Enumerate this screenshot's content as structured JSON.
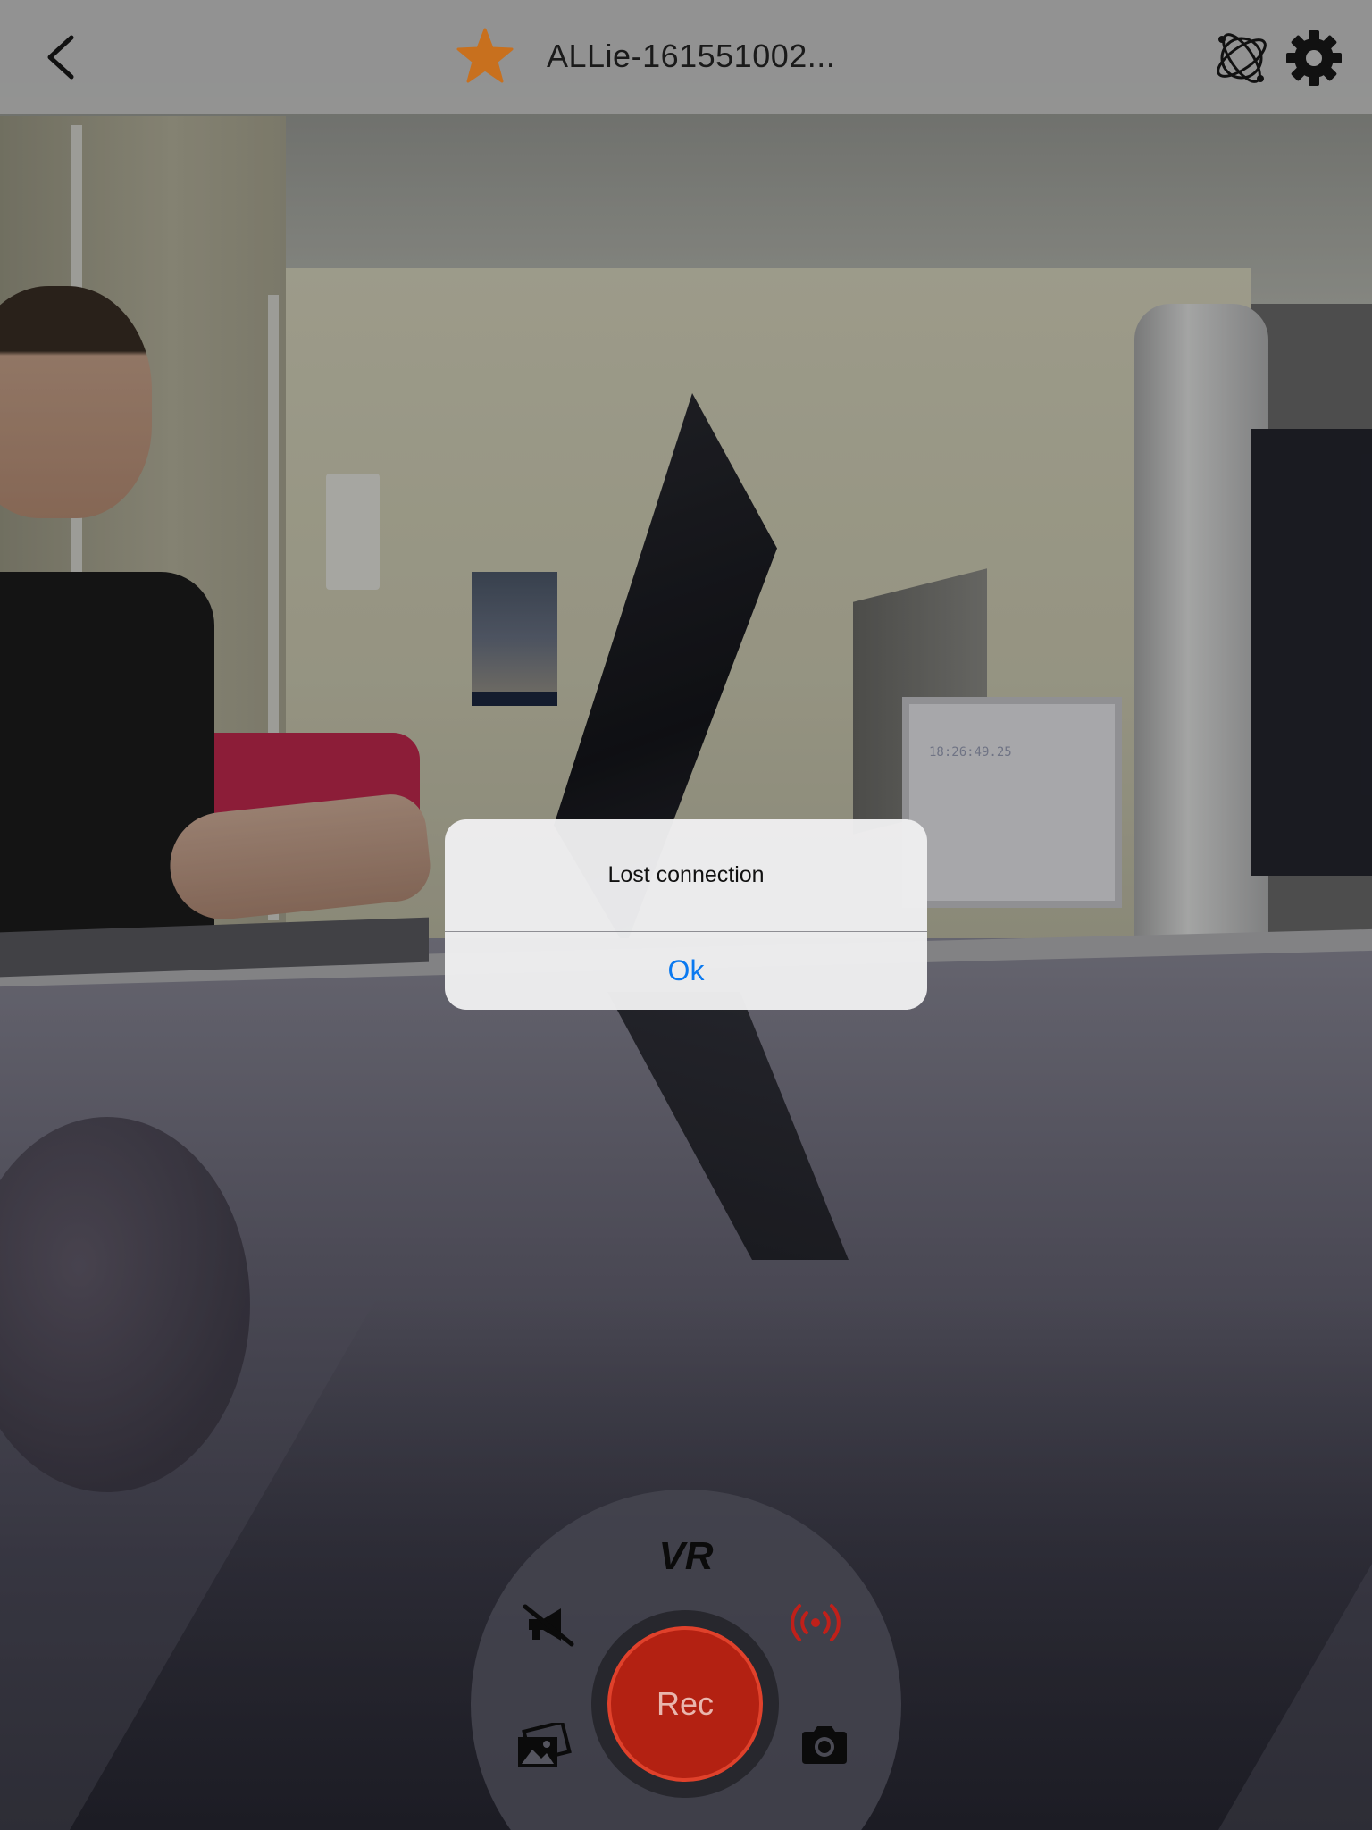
{
  "header": {
    "back_icon": "chevron-left-icon",
    "favorite_icon": "star-icon",
    "title": "ALLie-161551002...",
    "vr_mode_icon": "orbit-globe-icon",
    "settings_icon": "gear-icon"
  },
  "alert": {
    "message": "Lost connection",
    "ok_label": "Ok"
  },
  "controls": {
    "vr_label": "VR",
    "mute_icon": "megaphone-muted-icon",
    "broadcast_icon": "live-broadcast-icon",
    "gallery_icon": "gallery-icon",
    "camera_icon": "camera-icon",
    "record_label": "Rec"
  },
  "colors": {
    "accent_blue": "#0a79f0",
    "record_red": "#b32112",
    "broadcast_red": "#c0201a",
    "star_orange": "#c8701e"
  }
}
